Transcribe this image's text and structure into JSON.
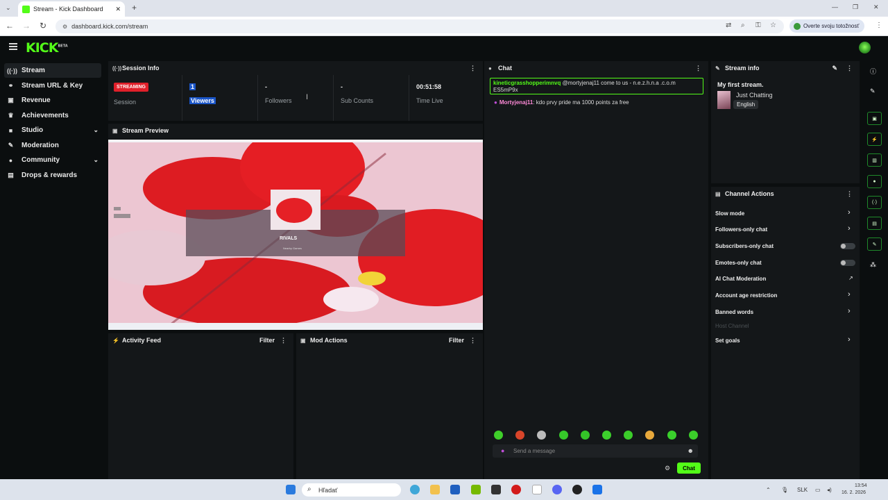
{
  "browser": {
    "tab_title": "Stream - Kick Dashboard",
    "new_tab": "+",
    "url": "dashboard.kick.com/stream",
    "verify_label": "Overte svoju totožnosť",
    "window_controls": [
      "—",
      "❐",
      "✕"
    ]
  },
  "app": {
    "logo": "KICK",
    "logo_badge": "BETA"
  },
  "sidebar": {
    "items": [
      {
        "label": "Stream",
        "icon": "broadcast-icon",
        "glyph": "((·))",
        "active": true
      },
      {
        "label": "Stream URL & Key",
        "icon": "link-icon",
        "glyph": "⚭"
      },
      {
        "label": "Revenue",
        "icon": "money-icon",
        "glyph": "▣"
      },
      {
        "label": "Achievements",
        "icon": "trophy-icon",
        "glyph": "♛"
      },
      {
        "label": "Studio",
        "icon": "video-icon",
        "glyph": "■",
        "expandable": true
      },
      {
        "label": "Moderation",
        "icon": "wrench-icon",
        "glyph": "✎"
      },
      {
        "label": "Community",
        "icon": "users-icon",
        "glyph": "●",
        "expandable": true
      },
      {
        "label": "Drops & rewards",
        "icon": "gift-icon",
        "glyph": "▤"
      }
    ]
  },
  "session": {
    "title": "Session Info",
    "badge": "STREAMING",
    "stats": [
      {
        "value": "",
        "label": "Session"
      },
      {
        "value": "1",
        "label": "Viewers"
      },
      {
        "value": "-",
        "label": "Followers"
      },
      {
        "value": "-",
        "label": "Sub Counts"
      },
      {
        "value": "00:51:58",
        "label": "Time Live"
      }
    ]
  },
  "preview": {
    "title": "Stream Preview",
    "game_title": "RIVALS",
    "game_sub": "Nearby Games"
  },
  "activity": {
    "title": "Activity Feed",
    "filter": "Filter"
  },
  "mod_actions": {
    "title": "Mod Actions",
    "filter": "Filter"
  },
  "chat": {
    "title": "Chat",
    "messages": [
      {
        "user": "kineticgrasshopperimnvq",
        "user_color": "#53fc18",
        "text": " @mortyjenaj11 come to us - n.e.z.h.n.a .c.o.m ES5mP9x",
        "highlighted": true
      },
      {
        "user": "Mortyjenaj11",
        "user_color": "#ff8ad8",
        "text": ": kdo prvy pride ma 1000 points za free"
      }
    ],
    "placeholder": "Send a message",
    "send_label": "Chat"
  },
  "stream_info": {
    "title": "Stream info",
    "stream_title": "My first stream.",
    "category": "Just Chatting",
    "language": "English"
  },
  "channel_actions": {
    "title": "Channel Actions",
    "items": [
      {
        "label": "Slow mode",
        "control": "chevron"
      },
      {
        "label": "Followers-only chat",
        "control": "chevron"
      },
      {
        "label": "Subscribers-only chat",
        "control": "toggle"
      },
      {
        "label": "Emotes-only chat",
        "control": "toggle"
      },
      {
        "label": "AI Chat Moderation",
        "control": "external"
      },
      {
        "label": "Account age restriction",
        "control": "chevron"
      },
      {
        "label": "Banned words",
        "control": "chevron"
      },
      {
        "label": "Host Channel",
        "control": "none",
        "disabled": true
      },
      {
        "label": "Set goals",
        "control": "chevron"
      }
    ]
  },
  "taskbar": {
    "search_placeholder": "Hľadať",
    "language": "SLK",
    "time": "13:54",
    "date": "16. 2. 2026"
  },
  "colors": {
    "accent": "#53fc18",
    "live": "#e0202a",
    "panel": "#141719",
    "background": "#0b0e0f"
  }
}
